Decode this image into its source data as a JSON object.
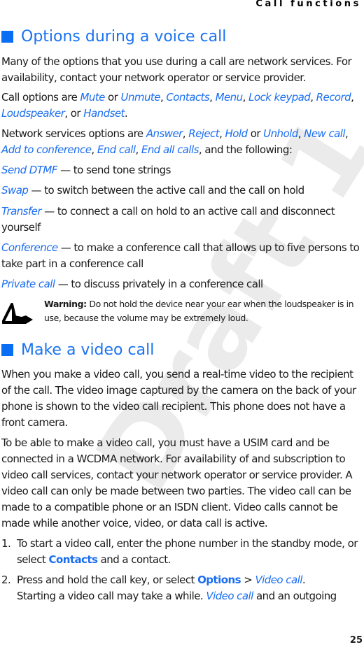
{
  "header": {
    "title": "Call functions"
  },
  "watermark": "Draft 1",
  "sections": [
    {
      "heading": "Options during a voice call"
    },
    {
      "heading": "Make a video call"
    }
  ],
  "paragraphs": [
    [
      {
        "t": "Many of the options that you use during a call are network services. For availability, contact your network operator or service provider."
      }
    ],
    [
      {
        "t": "Call options are "
      },
      {
        "t": "Mute",
        "s": "link"
      },
      {
        "t": " or "
      },
      {
        "t": "Unmute",
        "s": "link"
      },
      {
        "t": ", "
      },
      {
        "t": "Contacts",
        "s": "link"
      },
      {
        "t": ", "
      },
      {
        "t": "Menu",
        "s": "link"
      },
      {
        "t": ", "
      },
      {
        "t": "Lock keypad",
        "s": "link"
      },
      {
        "t": ", "
      },
      {
        "t": "Record",
        "s": "link"
      },
      {
        "t": ", "
      },
      {
        "t": "Loudspeaker",
        "s": "link"
      },
      {
        "t": ", or "
      },
      {
        "t": "Handset",
        "s": "link"
      },
      {
        "t": "."
      }
    ],
    [
      {
        "t": "Network services options are "
      },
      {
        "t": "Answer",
        "s": "link"
      },
      {
        "t": ", "
      },
      {
        "t": "Reject",
        "s": "link"
      },
      {
        "t": ", "
      },
      {
        "t": "Hold",
        "s": "link"
      },
      {
        "t": " or "
      },
      {
        "t": "Unhold",
        "s": "link"
      },
      {
        "t": ", "
      },
      {
        "t": "New call",
        "s": "link"
      },
      {
        "t": ", "
      },
      {
        "t": "Add to conference",
        "s": "link"
      },
      {
        "t": ", "
      },
      {
        "t": "End call",
        "s": "link"
      },
      {
        "t": ", "
      },
      {
        "t": "End all calls",
        "s": "link"
      },
      {
        "t": ", and the following:"
      }
    ],
    [
      {
        "t": "Send DTMF",
        "s": "link"
      },
      {
        "t": " — to send tone strings"
      }
    ],
    [
      {
        "t": "Swap",
        "s": "link"
      },
      {
        "t": " — to switch between the active call and the call on hold"
      }
    ],
    [
      {
        "t": "Transfer",
        "s": "link"
      },
      {
        "t": " — to connect a call on hold to an active call and disconnect yourself"
      }
    ],
    [
      {
        "t": "Conference",
        "s": "link"
      },
      {
        "t": " — to make a conference call that allows up to five persons to take part in a conference call"
      }
    ],
    [
      {
        "t": "Private call",
        "s": "link"
      },
      {
        "t": " — to discuss privately in a conference call"
      }
    ],
    [
      {
        "t": "When you make a video call, you send a real-time video to the recipient of the call. The video image captured by the camera on the back of your phone is shown to the video call recipient. This phone does not have a front camera."
      }
    ],
    [
      {
        "t": "To be able to make a video call, you must have a USIM card and be connected in a WCDMA network. For availability of and subscription to video call services, contact your network operator or service provider. A video call can only be made between two parties. The video call can be made to a compatible phone or an ISDN client. Video calls cannot be made while another voice, video, or data call is active."
      }
    ],
    [
      {
        "t": "1.",
        "s": "num"
      },
      {
        "t": "To start a video call, enter the phone number in the standby mode, or select "
      },
      {
        "t": "Contacts",
        "s": "ui"
      },
      {
        "t": " and a contact."
      }
    ],
    [
      {
        "t": "2.",
        "s": "num"
      },
      {
        "t": "Press and hold the call key, or select "
      },
      {
        "t": "Options",
        "s": "ui"
      },
      {
        "t": " > "
      },
      {
        "t": "Video call",
        "s": "link"
      },
      {
        "t": "."
      },
      {
        "br": true
      },
      {
        "t": "Starting a video call may take a while. "
      },
      {
        "t": "Video call",
        "s": "link"
      },
      {
        "t": " and an outgoing"
      }
    ]
  ],
  "warning": {
    "label": "Warning:",
    "text": " Do not hold the device near your ear when the loudspeaker is in use, because the volume may be extremely loud.",
    "icon": "warning-triangle-hand-icon"
  },
  "page_number": "25",
  "colors": {
    "accent": "#1a6ef0"
  }
}
